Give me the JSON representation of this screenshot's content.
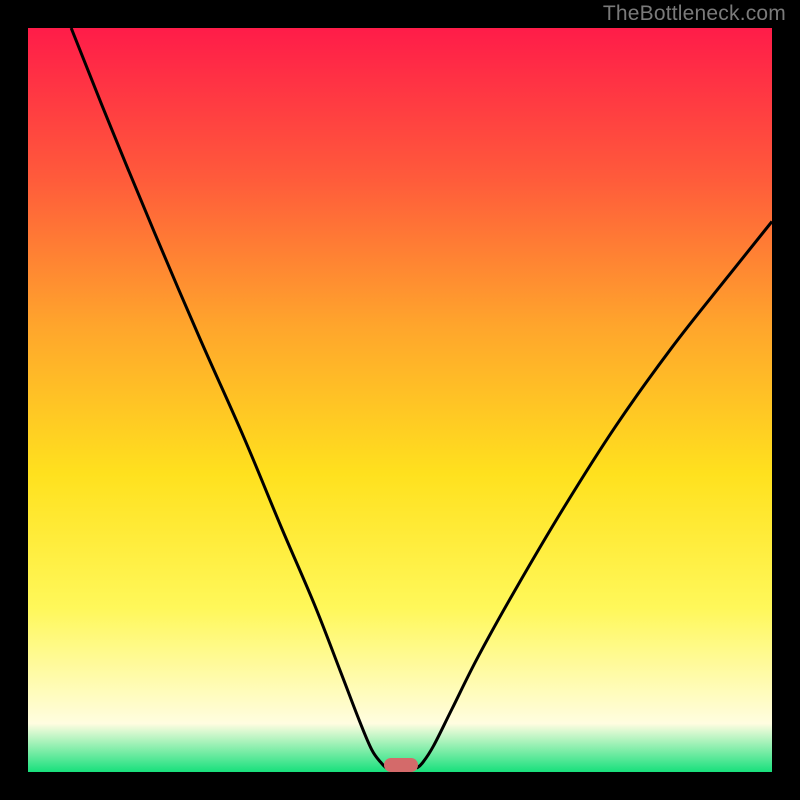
{
  "chart_data": {
    "type": "line",
    "title": "",
    "xlabel": "",
    "ylabel": "",
    "xlim": [
      0,
      10
    ],
    "ylim": [
      0,
      10
    ],
    "grid": false,
    "legend": false,
    "series": [
      {
        "name": "left-branch",
        "x": [
          0.58,
          1.1,
          1.7,
          2.3,
          2.9,
          3.4,
          3.85,
          4.2,
          4.45,
          4.62,
          4.75,
          4.82
        ],
        "values": [
          10.0,
          8.7,
          7.25,
          5.85,
          4.5,
          3.3,
          2.25,
          1.35,
          0.7,
          0.3,
          0.12,
          0.05
        ]
      },
      {
        "name": "right-branch",
        "x": [
          5.22,
          5.3,
          5.45,
          5.7,
          6.05,
          6.55,
          7.2,
          7.9,
          8.65,
          9.4,
          10.0
        ],
        "values": [
          0.05,
          0.12,
          0.35,
          0.85,
          1.55,
          2.45,
          3.55,
          4.65,
          5.7,
          6.65,
          7.4
        ]
      }
    ],
    "marker": {
      "cx": 5.02,
      "cy": 0.09,
      "label": "optimal-point"
    },
    "background_gradient": {
      "stops": [
        {
          "pct": 0,
          "color": "#ff1c49"
        },
        {
          "pct": 20,
          "color": "#ff5a3b"
        },
        {
          "pct": 40,
          "color": "#ffa52c"
        },
        {
          "pct": 60,
          "color": "#ffe11e"
        },
        {
          "pct": 78,
          "color": "#fff85a"
        },
        {
          "pct": 93.5,
          "color": "#fffde0"
        },
        {
          "pct": 100,
          "color": "#18e07c"
        }
      ]
    },
    "stroke": {
      "color": "#000000",
      "width": 3
    }
  },
  "watermark": {
    "text": "TheBottleneck.com"
  }
}
